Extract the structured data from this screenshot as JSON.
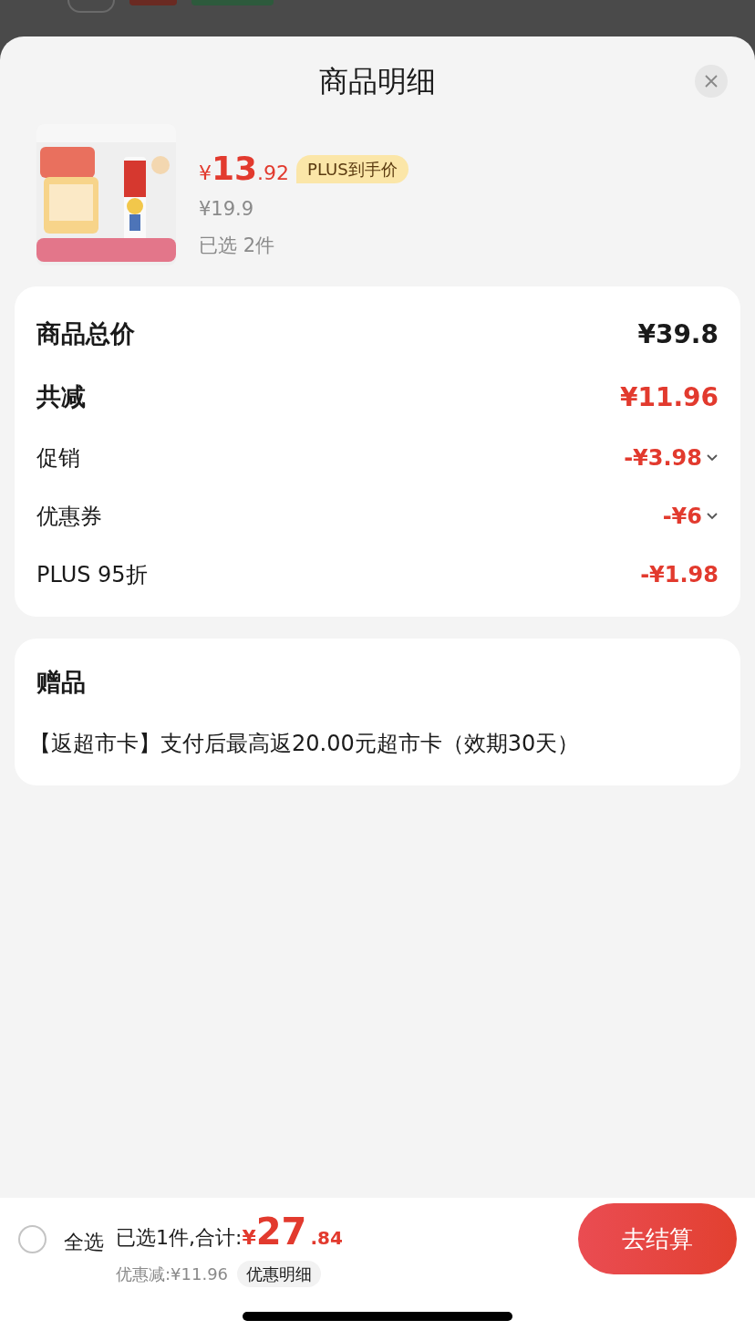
{
  "header": {
    "title": "商品明细"
  },
  "product": {
    "currency": "¥",
    "price_int": "13",
    "price_dec": ".92",
    "tag": "PLUS到手价",
    "original_price": "¥19.9",
    "quantity": "已选 2件"
  },
  "summary": [
    {
      "label": "商品总价",
      "value": "¥39.8",
      "kind": "total",
      "expandable": false
    },
    {
      "label": "共减",
      "value": "¥11.96",
      "kind": "saving",
      "expandable": false
    },
    {
      "label": "促销",
      "value": "-¥3.98",
      "kind": "discount",
      "expandable": true
    },
    {
      "label": "优惠券",
      "value": "-¥6",
      "kind": "discount",
      "expandable": true
    },
    {
      "label": "PLUS 95折",
      "value": "-¥1.98",
      "kind": "discount",
      "expandable": false
    }
  ],
  "gift": {
    "title": "赠品",
    "text": "【返超市卡】支付后最高返20.00元超市卡（效期30天）"
  },
  "footer": {
    "select_all": {
      "label": "全选",
      "checked": false
    },
    "selected_text": "已选1件,合计:",
    "currency": "¥",
    "total_int": "27",
    "total_dec": ".84",
    "discount_text": "优惠减:¥11.96",
    "detail_button": "优惠明细",
    "checkout": "去结算"
  }
}
